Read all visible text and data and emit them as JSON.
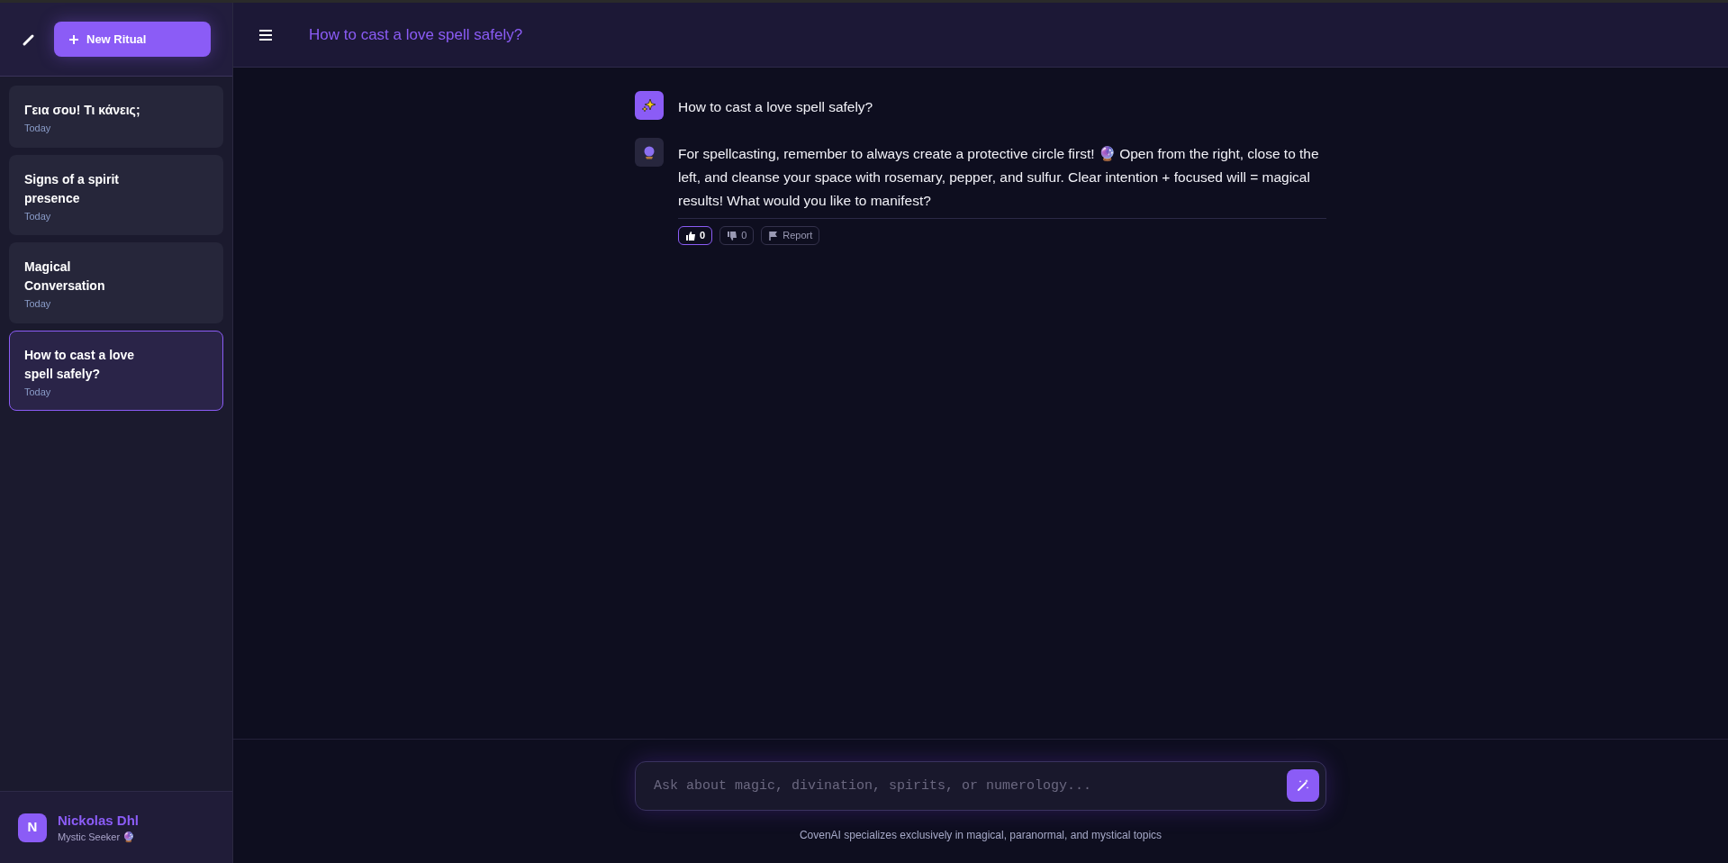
{
  "sidebar": {
    "new_button": "New Ritual",
    "conversations": [
      {
        "title": "Γεια σου! Τι κάνεις;",
        "date": "Today",
        "selected": false
      },
      {
        "title": "Signs of a spirit presence",
        "date": "Today",
        "selected": false
      },
      {
        "title": "Magical Conversation",
        "date": "Today",
        "selected": false
      },
      {
        "title": "How to cast a love spell safely?",
        "date": "Today",
        "selected": true
      }
    ],
    "user": {
      "initial": "N",
      "name": "Nickolas Dhl",
      "role": "Mystic Seeker 🔮"
    }
  },
  "header": {
    "title": "How to cast a love spell safely?"
  },
  "messages": [
    {
      "kind": "user",
      "text": "How to cast a love spell safely?"
    },
    {
      "kind": "assistant",
      "text": "For spellcasting, remember to always create a protective circle first! 🔮 Open from the right, close to the left, and cleanse your space with rosemary, pepper, and sulfur. Clear intention + focused will = magical results! What would you like to manifest?",
      "feedback": {
        "like_count": "0",
        "liked": true,
        "dislike_count": "0",
        "disliked": false,
        "report": "Report"
      }
    }
  ],
  "composer": {
    "placeholder": "Ask about magic, divination, spirits, or numerology..."
  },
  "footer_note": "CovenAI specializes exclusively in magical, paranormal, and mystical topics"
}
